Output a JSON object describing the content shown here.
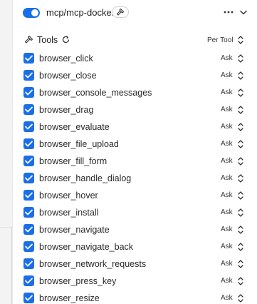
{
  "header": {
    "server_name": "mcp/mcp-docker",
    "enabled": true,
    "icons": {
      "toggle": "toggle-switch-icon",
      "pill": "hammer-icon",
      "more": "more-horizontal-icon",
      "collapse": "chevron-down-icon"
    }
  },
  "tools_bar": {
    "label": "Tools",
    "mode_label": "Per Tool",
    "icons": {
      "tools": "hammer-icon",
      "refresh": "refresh-icon",
      "mode": "chevron-up-down-icon"
    }
  },
  "tools": [
    {
      "name": "browser_click",
      "enabled": true,
      "permission": "Ask"
    },
    {
      "name": "browser_close",
      "enabled": true,
      "permission": "Ask"
    },
    {
      "name": "browser_console_messages",
      "enabled": true,
      "permission": "Ask"
    },
    {
      "name": "browser_drag",
      "enabled": true,
      "permission": "Ask"
    },
    {
      "name": "browser_evaluate",
      "enabled": true,
      "permission": "Ask"
    },
    {
      "name": "browser_file_upload",
      "enabled": true,
      "permission": "Ask"
    },
    {
      "name": "browser_fill_form",
      "enabled": true,
      "permission": "Ask"
    },
    {
      "name": "browser_handle_dialog",
      "enabled": true,
      "permission": "Ask"
    },
    {
      "name": "browser_hover",
      "enabled": true,
      "permission": "Ask"
    },
    {
      "name": "browser_install",
      "enabled": true,
      "permission": "Ask"
    },
    {
      "name": "browser_navigate",
      "enabled": true,
      "permission": "Ask"
    },
    {
      "name": "browser_navigate_back",
      "enabled": true,
      "permission": "Ask"
    },
    {
      "name": "browser_network_requests",
      "enabled": true,
      "permission": "Ask"
    },
    {
      "name": "browser_press_key",
      "enabled": true,
      "permission": "Ask"
    },
    {
      "name": "browser_resize",
      "enabled": true,
      "permission": "Ask"
    }
  ],
  "colors": {
    "accent": "#1a6ee8",
    "background": "#ffffff",
    "text": "#1f1f1f"
  }
}
